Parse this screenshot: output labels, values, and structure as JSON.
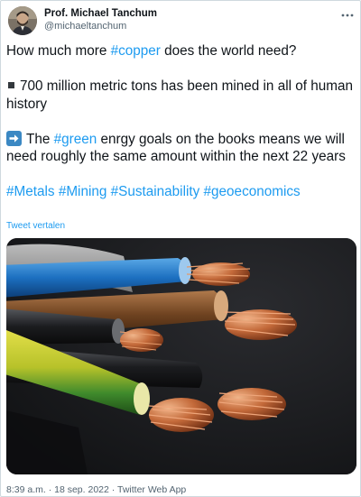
{
  "tweet": {
    "author": {
      "display_name": "Prof. Michael Tanchum",
      "handle": "@michaeltanchum"
    },
    "text": {
      "line1_pre": "How much more ",
      "line1_tag": "#copper",
      "line1_post": " does the world need?",
      "bullet_text": "700 million metric tons has been mined in all of human history",
      "arrow_pre": "The ",
      "arrow_tag": "#green",
      "arrow_post": " enrgy goals on the books means we will need roughly the same amount within the next 22 years",
      "hashtags": [
        "#Metals",
        "#Mining",
        "#Sustainability",
        "#geoeconomics"
      ]
    },
    "translate_label": "Tweet vertalen",
    "media": {
      "description_icon": "copper-cables-photo"
    },
    "footer": {
      "time": "8:39 a.m.",
      "separator1": " · ",
      "date": "18 sep. 2022",
      "separator2": " · ",
      "source": "Twitter Web App"
    }
  },
  "icons": {
    "more": "more-horizontal-icon",
    "arrow": "right-arrow-icon",
    "bullet": "black-square-icon"
  },
  "colors": {
    "link": "#1d9bf0",
    "text": "#0f1419",
    "secondary": "#536471",
    "arrow_bg": "#3b88c3"
  }
}
